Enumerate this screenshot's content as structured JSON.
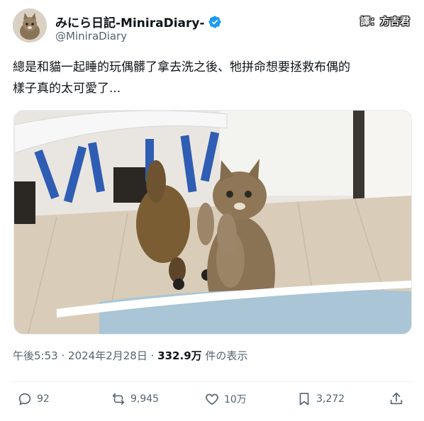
{
  "author": {
    "display_name": "みにら日記-MiniraDiary-",
    "handle": "@MiniraDiary",
    "verified": true
  },
  "translator_label": "譯：方吉君",
  "tweet": {
    "lines": [
      "總是和貓一起睡的玩偶髒了拿去洗之後、牠拼命想要拯救布偶的",
      "樣子真的太可愛了..."
    ]
  },
  "meta": {
    "time": "午後5:53",
    "sep1": "·",
    "date": "2024年2月28日",
    "sep2": "·",
    "views_count": "332.9万",
    "views_label": "件の表示"
  },
  "actions": {
    "reply_count": "92",
    "retweet_count": "9,945",
    "like_count": "10万",
    "bookmark_count": "3,272"
  },
  "colors": {
    "text_primary": "#0f1419",
    "text_secondary": "#536471",
    "verified_blue": "#1d9bf0"
  }
}
